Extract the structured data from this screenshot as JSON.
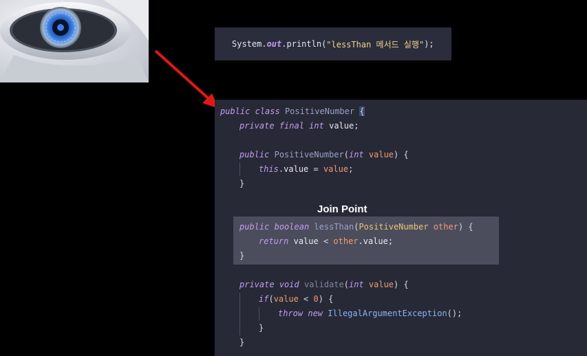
{
  "image": {
    "icon": "robot-eye-image",
    "colors": {
      "iris": "#3d7fe3",
      "metal": "#c9ccd3"
    }
  },
  "arrow": {
    "color": "#e01818"
  },
  "snippet": {
    "prefix": "System.",
    "field": "out",
    "mid": ".println(",
    "string": "\"lessThan 메서드 실행\"",
    "suffix": ");"
  },
  "join_point_label": "Join Point",
  "code": {
    "l1": {
      "public": "public",
      "class": "class",
      "name": "PositiveNumber",
      "brace": "{"
    },
    "l2": {
      "private": "private",
      "final": "final",
      "int": "int",
      "field": "value",
      "semi": ";"
    },
    "l3": {
      "public": "public",
      "name": "PositiveNumber",
      "open": "(",
      "int": "int",
      "param": "value",
      "close": ") {"
    },
    "l4": {
      "this": "this",
      "dot": ".",
      "field": "value",
      "eq": " = ",
      "param": "value",
      "semi": ";"
    },
    "l5": {
      "brace": "}"
    },
    "l6": {
      "public": "public",
      "boolean": "boolean",
      "name": "lessThan",
      "open": "(",
      "type": "PositiveNumber",
      "param": "other",
      "close": ") {"
    },
    "l7": {
      "return": "return",
      "field": "value",
      "op": " < ",
      "param": "other",
      "rest": ".value;"
    },
    "l8": {
      "brace": "}"
    },
    "l9": {
      "private": "private",
      "void": "void",
      "name": "validate",
      "open": "(",
      "int": "int",
      "param": "value",
      "close": ") {"
    },
    "l10": {
      "if": "if",
      "open": "(",
      "param": "value",
      "op": " < ",
      "num": "0",
      "close": ") {"
    },
    "l11": {
      "throw": "throw",
      "new": "new",
      "cls": "IllegalArgumentException",
      "rest": "();"
    },
    "l12": {
      "brace": "}"
    },
    "l13": {
      "brace": "}"
    }
  }
}
